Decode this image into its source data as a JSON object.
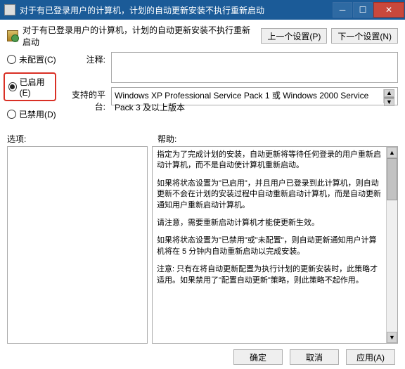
{
  "window": {
    "title": "对于有已登录用户的计算机，计划的自动更新安装不执行重新启动"
  },
  "header": {
    "text": "对于有已登录用户的计算机，计划的自动更新安装不执行重新启动",
    "prev": "上一个设置(P)",
    "next": "下一个设置(N)"
  },
  "radios": {
    "not_configured": "未配置(C)",
    "enabled": "已启用(E)",
    "disabled": "已禁用(D)"
  },
  "fields": {
    "comment_label": "注释:",
    "platform_label": "支持的平台:",
    "platform_text": "Windows XP Professional Service Pack 1 或 Windows 2000 Service Pack 3 及以上版本"
  },
  "sections": {
    "options_label": "选项:",
    "help_label": "帮助:"
  },
  "help": {
    "p1": "指定为了完成计划的安装，自动更新将等待任何登录的用户重新启动计算机，而不是自动使计算机重新启动。",
    "p2": "如果将状态设置为\"已启用\"，并且用户已登录到此计算机，则自动更新不会在计划的安装过程中自动重新启动计算机，而是自动更新通知用户重新启动计算机。",
    "p3": "请注意，需要重新启动计算机才能使更新生效。",
    "p4": "如果将状态设置为\"已禁用\"或\"未配置\"，则自动更新通知用户计算机将在 5 分钟内自动重新启动以完成安装。",
    "p5": "注意: 只有在将自动更新配置为执行计划的更新安装时，此策略才适用。如果禁用了\"配置自动更新\"策略，则此策略不起作用。"
  },
  "buttons": {
    "ok": "确定",
    "cancel": "取消",
    "apply": "应用(A)"
  }
}
